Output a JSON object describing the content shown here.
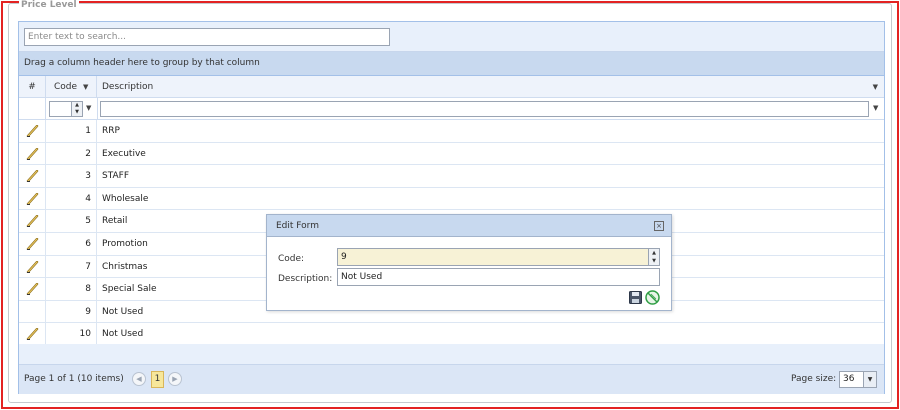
{
  "panel": {
    "legend": "Price Level"
  },
  "search": {
    "placeholder": "Enter text to search..."
  },
  "group_panel": {
    "text": "Drag a column header here to group by that column"
  },
  "columns": {
    "hash": "#",
    "code": "Code",
    "description": "Description"
  },
  "rows": [
    {
      "code": "1",
      "description": "RRP",
      "editable": true
    },
    {
      "code": "2",
      "description": "Executive",
      "editable": true
    },
    {
      "code": "3",
      "description": "STAFF",
      "editable": true
    },
    {
      "code": "4",
      "description": "Wholesale",
      "editable": true
    },
    {
      "code": "5",
      "description": "Retail",
      "editable": true
    },
    {
      "code": "6",
      "description": "Promotion",
      "editable": true
    },
    {
      "code": "7",
      "description": "Christmas",
      "editable": true
    },
    {
      "code": "8",
      "description": "Special Sale",
      "editable": true
    },
    {
      "code": "9",
      "description": "Not Used",
      "editable": false
    },
    {
      "code": "10",
      "description": "Not Used",
      "editable": true
    }
  ],
  "pager": {
    "info": "Page 1 of 1 (10 items)",
    "current_page": "1",
    "page_size_label": "Page size:",
    "page_size": "36"
  },
  "edit_form": {
    "title": "Edit Form",
    "code_label": "Code:",
    "code_value": "9",
    "description_label": "Description:",
    "description_value": "Not Used"
  },
  "colors": {
    "frame_border": "#e32222",
    "group_panel_bg": "#c8d9ef",
    "selected_page_bg": "#f7e79a",
    "code_input_bg": "#f7f2d6"
  },
  "icons": {
    "edit": "pencil-icon",
    "filter": "filter-icon",
    "save": "save-icon",
    "cancel": "cancel-icon",
    "close": "close-icon"
  }
}
